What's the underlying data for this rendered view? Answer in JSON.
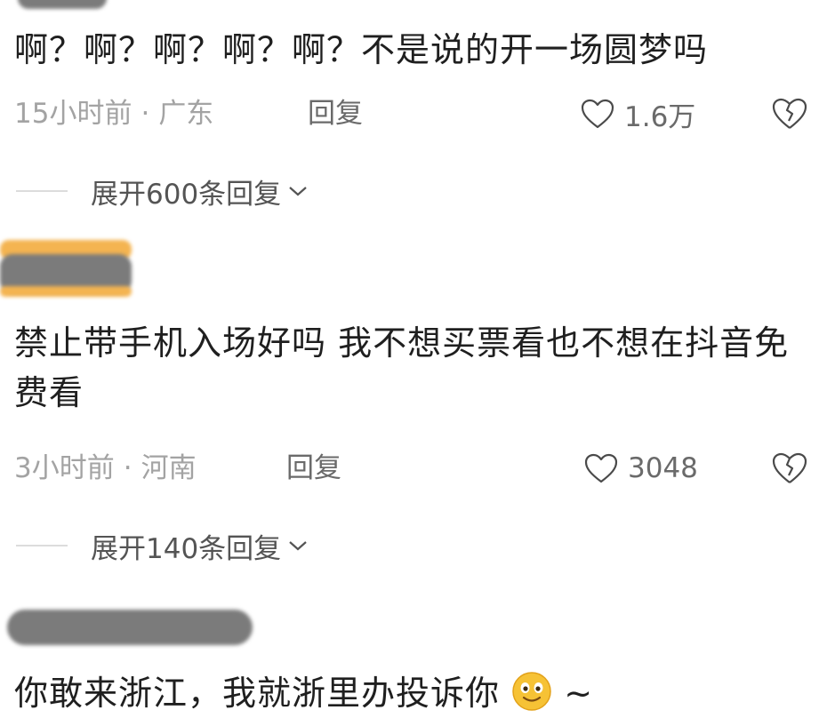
{
  "comments": [
    {
      "text": "啊？啊？啊？啊？啊？不是说的开一场圆梦吗",
      "time": "15小时前",
      "dot": "·",
      "location": "广东",
      "reply_label": "回复",
      "likes": "1.6万",
      "expand_label": "展开600条回复"
    },
    {
      "text": "禁止带手机入场好吗 我不想买票看也不想在抖音免费看",
      "time": "3小时前",
      "dot": "·",
      "location": "河南",
      "reply_label": "回复",
      "likes": "3048",
      "expand_label": "展开140条回复"
    },
    {
      "text": "你敢来浙江，我就浙里办投诉你",
      "suffix": "~"
    }
  ],
  "icons": {
    "like": "heart-outline-icon",
    "dislike": "broken-heart-icon",
    "expand": "chevron-down-icon",
    "emoji": "smiley-emoji-icon"
  },
  "colors": {
    "text": "#1f1f1f",
    "meta": "#a3a3a3",
    "action": "#6a6a6a",
    "expand": "#545454",
    "emoji": "#f6c235"
  }
}
